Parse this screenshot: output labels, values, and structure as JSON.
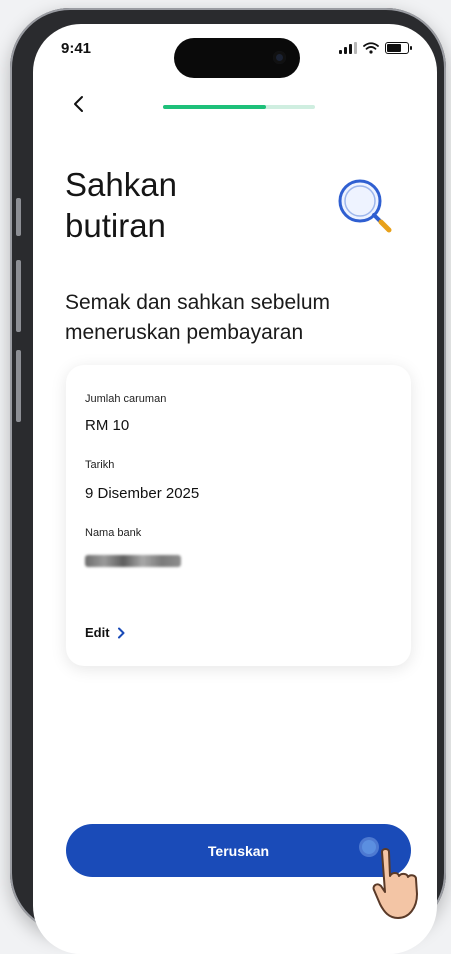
{
  "status_bar": {
    "time": "9:41"
  },
  "icons": {
    "back": "chevron-left-icon",
    "magnifier": "magnifying-glass-icon",
    "edit_chevron": "chevron-right-icon",
    "cursor": "hand-pointer-icon"
  },
  "progress": {
    "value": 0.68
  },
  "header": {
    "title_line1": "Sahkan",
    "title_line2": "butiran"
  },
  "subtitle": "Semak dan sahkan sebelum meneruskan pembayaran",
  "details": {
    "contribution_label": "Jumlah caruman",
    "contribution_value": "RM 10",
    "date_label": "Tarikh",
    "date_value": "9 Disember 2025",
    "bank_label": "Nama bank",
    "edit_label": "Edit"
  },
  "continue_label": "Teruskan",
  "colors": {
    "primary": "#1a4bb8",
    "progress": "#1ec07a",
    "progress_track": "#cfeee0",
    "magnifier_ring": "#2f5fd1",
    "magnifier_handle": "#e8a11a"
  }
}
